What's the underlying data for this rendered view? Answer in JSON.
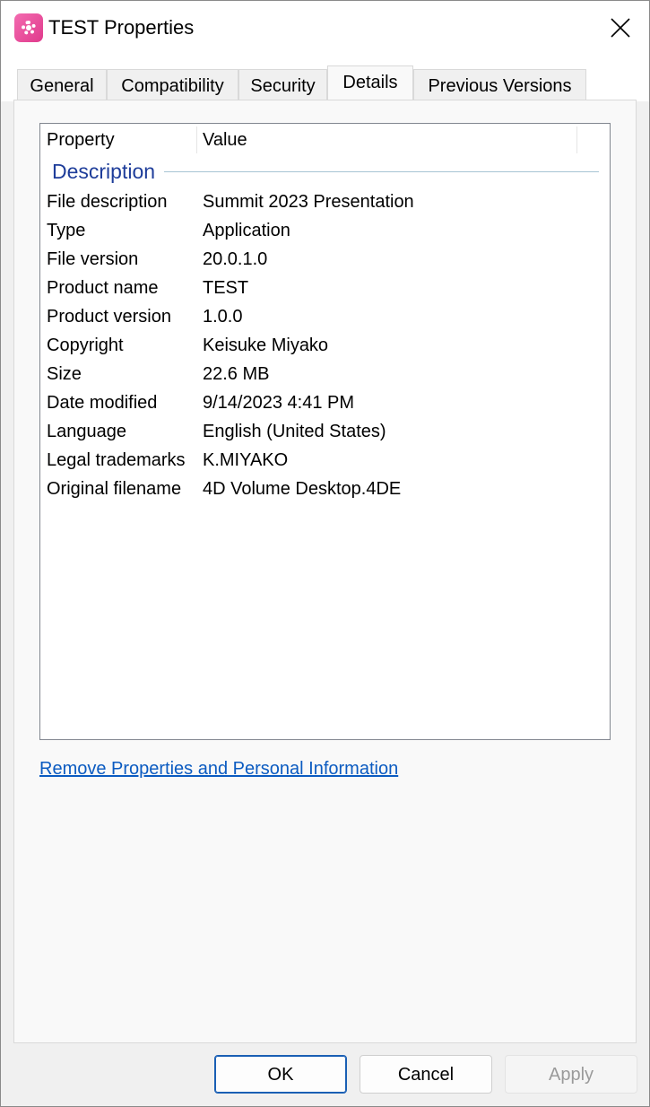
{
  "window": {
    "title": "TEST Properties",
    "close_icon": "close-icon",
    "app_icon": "app-icon"
  },
  "tabs": [
    {
      "label": "General",
      "active": false
    },
    {
      "label": "Compatibility",
      "active": false
    },
    {
      "label": "Security",
      "active": false
    },
    {
      "label": "Details",
      "active": true
    },
    {
      "label": "Previous Versions",
      "active": false
    }
  ],
  "details": {
    "columns": {
      "property": "Property",
      "value": "Value"
    },
    "group_title": "Description",
    "rows": [
      {
        "property": "File description",
        "value": "Summit 2023 Presentation"
      },
      {
        "property": "Type",
        "value": "Application"
      },
      {
        "property": "File version",
        "value": "20.0.1.0"
      },
      {
        "property": "Product name",
        "value": "TEST"
      },
      {
        "property": "Product version",
        "value": "1.0.0"
      },
      {
        "property": "Copyright",
        "value": "Keisuke Miyako"
      },
      {
        "property": "Size",
        "value": "22.6 MB"
      },
      {
        "property": "Date modified",
        "value": "9/14/2023 4:41 PM"
      },
      {
        "property": "Language",
        "value": "English (United States)"
      },
      {
        "property": "Legal trademarks",
        "value": "K.MIYAKO"
      },
      {
        "property": "Original filename",
        "value": "4D Volume Desktop.4DE"
      }
    ],
    "remove_link": "Remove Properties and Personal Information"
  },
  "buttons": {
    "ok": "OK",
    "cancel": "Cancel",
    "apply": "Apply"
  },
  "colors": {
    "group_title": "#1e3d9a",
    "link": "#0b5bc1",
    "primary_border": "#1a5fb4"
  }
}
